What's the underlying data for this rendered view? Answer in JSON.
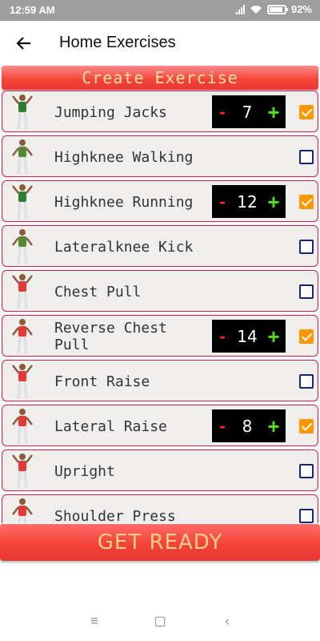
{
  "status": {
    "time": "12:59 AM",
    "battery": "92%"
  },
  "toolbar": {
    "title": "Home Exercises",
    "back_icon": "arrow-back-icon"
  },
  "create_label": "Create Exercise",
  "exercises": [
    {
      "name": "Jumping Jacks",
      "count": "7",
      "checked": true
    },
    {
      "name": "Highknee Walking",
      "count": null,
      "checked": false
    },
    {
      "name": "Highknee Running",
      "count": "12",
      "checked": true
    },
    {
      "name": "Lateralknee Kick",
      "count": null,
      "checked": false
    },
    {
      "name": "Chest Pull",
      "count": null,
      "checked": false
    },
    {
      "name": "Reverse Chest Pull",
      "count": "14",
      "checked": true
    },
    {
      "name": "Front Raise",
      "count": null,
      "checked": false
    },
    {
      "name": "Lateral Raise",
      "count": "8",
      "checked": true
    },
    {
      "name": "Upright",
      "count": null,
      "checked": false
    },
    {
      "name": "Shoulder Press",
      "count": null,
      "checked": false
    }
  ],
  "stepper_labels": {
    "minus": "-",
    "plus": "+"
  },
  "get_ready_label": "GET READY",
  "nav": {
    "menu_icon": "≡",
    "home_icon": "▢",
    "back_icon": "‹"
  },
  "colors": {
    "accent_red": "#f44336",
    "checkbox_orange": "#ff9800",
    "stepper_plus": "#4ee11b",
    "stepper_minus": "#ff2a2a"
  }
}
